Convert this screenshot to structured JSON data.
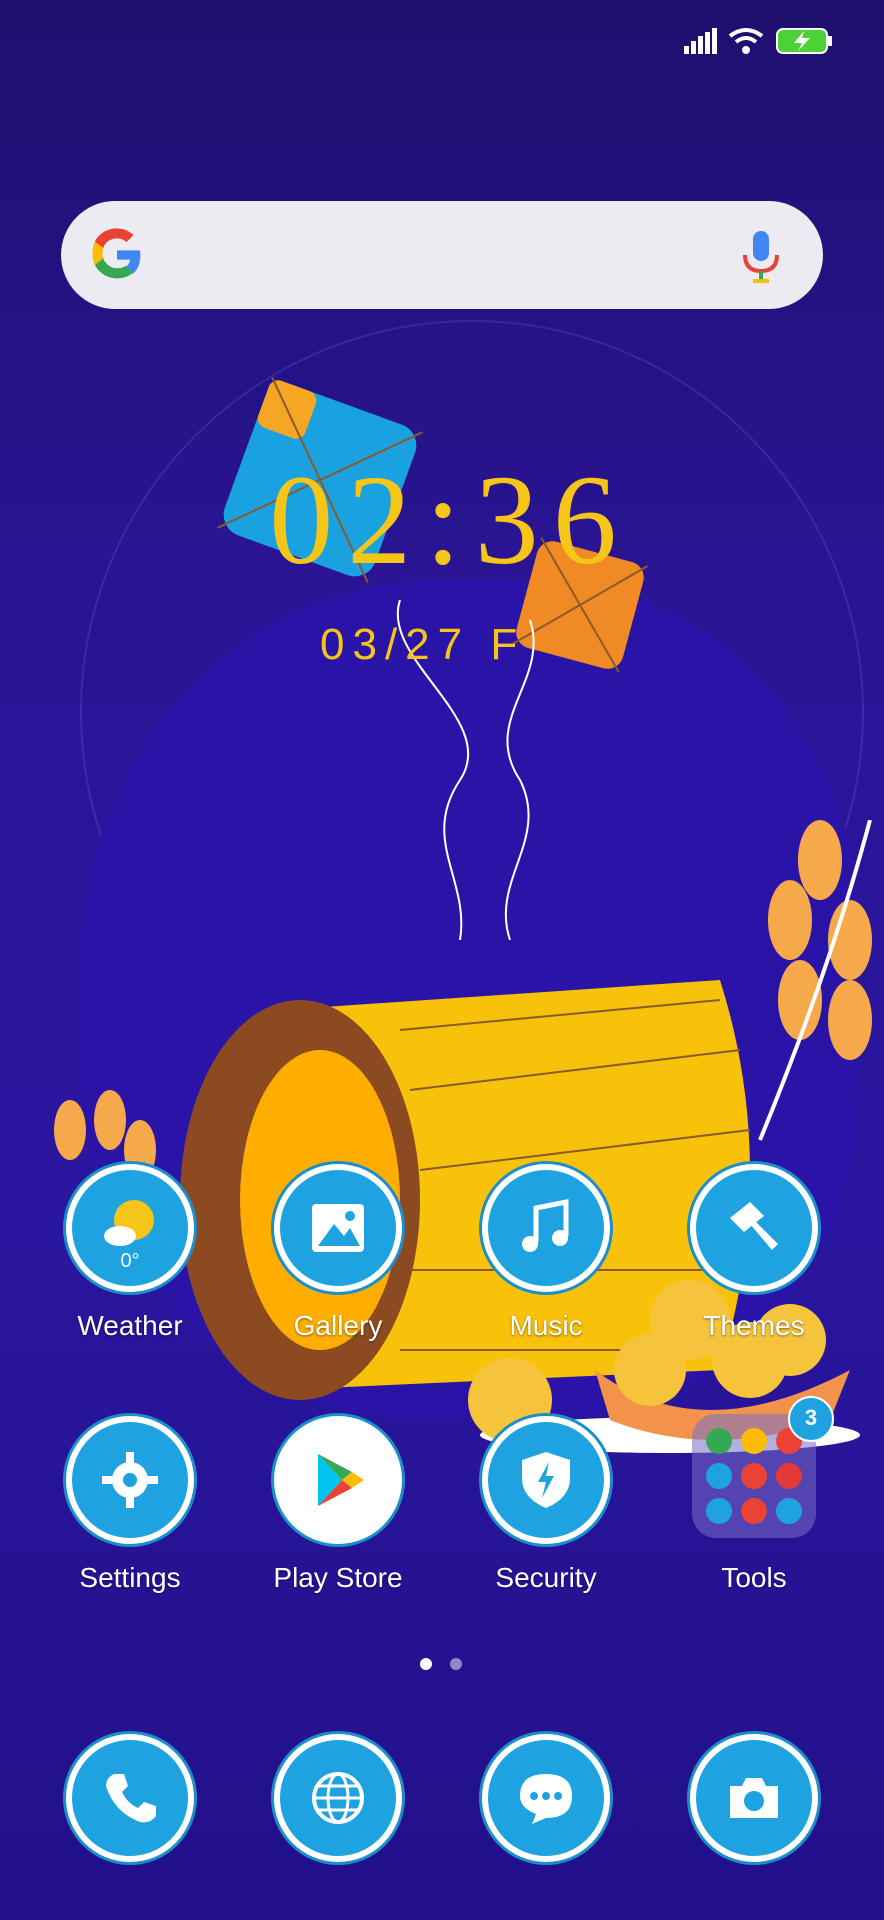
{
  "status_bar": {
    "battery_icon": "battery-charging-icon",
    "wifi_icon": "wifi-icon",
    "signal_icon": "signal-icon"
  },
  "search": {
    "logo": "google-logo",
    "mic_icon": "mic-icon"
  },
  "clock": {
    "time": "02:36",
    "date": "03/27 F"
  },
  "apps_row1": [
    {
      "label": "Weather",
      "icon": "weather-icon",
      "value": "0°"
    },
    {
      "label": "Gallery",
      "icon": "image-icon"
    },
    {
      "label": "Music",
      "icon": "music-note-icon"
    },
    {
      "label": "Themes",
      "icon": "paintbrush-icon"
    }
  ],
  "apps_row2": [
    {
      "label": "Settings",
      "icon": "gear-icon"
    },
    {
      "label": "Play Store",
      "icon": "play-store-icon"
    },
    {
      "label": "Security",
      "icon": "shield-icon"
    },
    {
      "label": "Tools",
      "icon": "folder-icon",
      "badge": "3"
    }
  ],
  "page_indicator": {
    "pages": 2,
    "active": 1
  },
  "dock": [
    {
      "icon": "phone-icon"
    },
    {
      "icon": "browser-globe-icon"
    },
    {
      "icon": "messages-icon"
    },
    {
      "icon": "camera-icon"
    }
  ],
  "colors": {
    "accent": "#1ea2e0",
    "clock": "#f5c518",
    "background": "#2a1494"
  }
}
